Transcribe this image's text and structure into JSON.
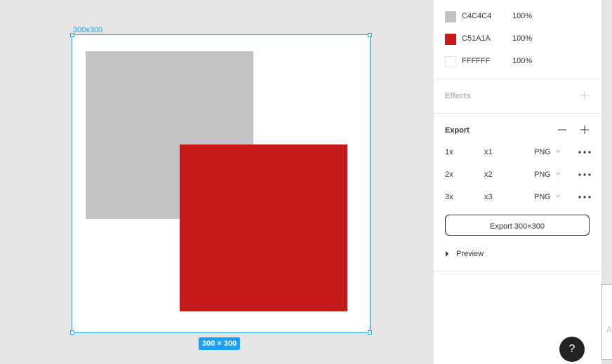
{
  "canvas": {
    "frame_label": "300x300",
    "size_badge": "300 × 300",
    "selection_color": "#18a0fb",
    "shapes": [
      {
        "name": "gray-square",
        "color": "#C4C4C4"
      },
      {
        "name": "red-square",
        "color": "#C51A1A"
      }
    ]
  },
  "fills": [
    {
      "hex": "C4C4C4",
      "opacity": "100%",
      "color": "#c4c4c4"
    },
    {
      "hex": "C51A1A",
      "opacity": "100%",
      "color": "#c51a1a"
    },
    {
      "hex": "FFFFFF",
      "opacity": "100%",
      "color": "#ffffff"
    }
  ],
  "effects": {
    "title": "Effects",
    "add_icon": "plus-icon"
  },
  "export": {
    "title": "Export",
    "remove_icon": "minus-icon",
    "add_icon": "plus-icon",
    "rows": [
      {
        "scale": "1x",
        "suffix": "x1",
        "format": "PNG"
      },
      {
        "scale": "2x",
        "suffix": "x2",
        "format": "PNG"
      },
      {
        "scale": "3x",
        "suffix": "x3",
        "format": "PNG"
      }
    ],
    "button_label": "Export 300×300",
    "preview_label": "Preview"
  },
  "help": {
    "label": "?"
  },
  "side_strip": {
    "char": "A"
  }
}
